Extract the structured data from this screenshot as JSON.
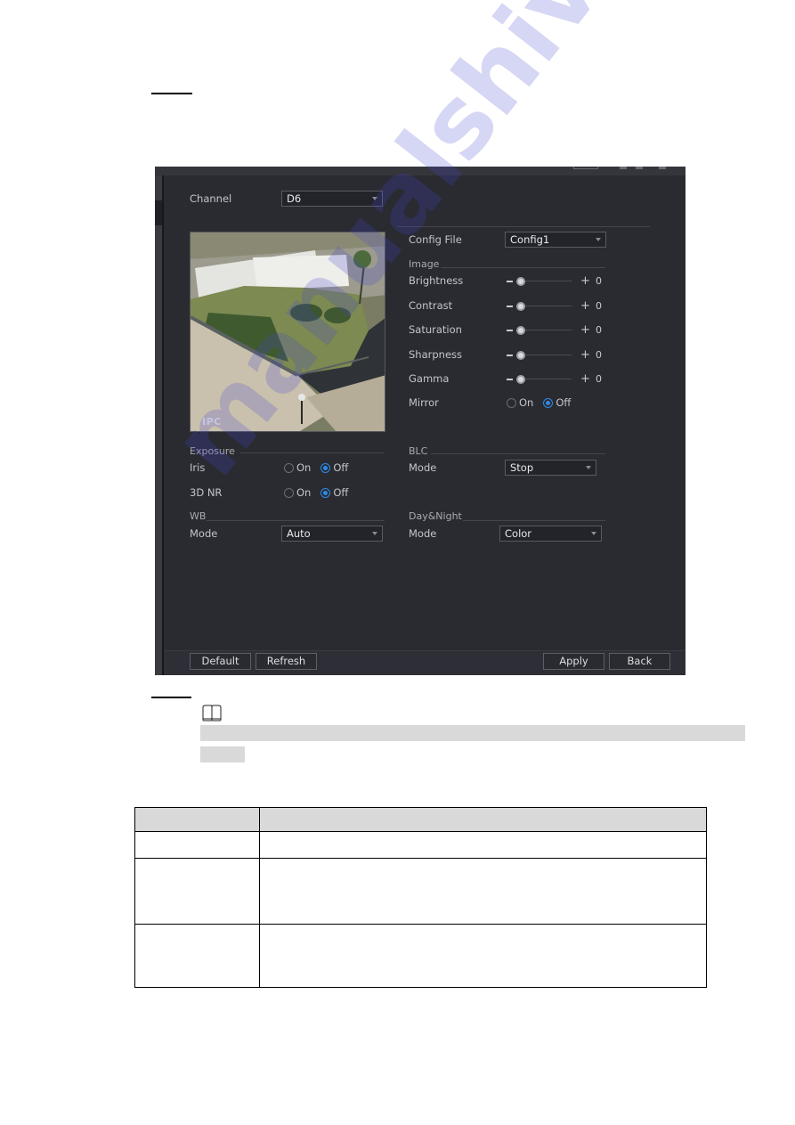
{
  "document": {
    "watermark": "manualshive.com",
    "note_icon": "book-icon",
    "table": {
      "header": [
        "",
        ""
      ],
      "rows": [
        [
          "",
          ""
        ],
        [
          "",
          ""
        ],
        [
          "",
          ""
        ]
      ]
    }
  },
  "ui": {
    "channel": {
      "label": "Channel",
      "value": "D6"
    },
    "preview": {
      "overlay_text": "IPC"
    },
    "config_file": {
      "label": "Config File",
      "value": "Config1"
    },
    "image_group": {
      "title": "Image",
      "sliders": [
        {
          "label": "Brightness",
          "value": "0",
          "position": 0.0
        },
        {
          "label": "Contrast",
          "value": "0",
          "position": 0.0
        },
        {
          "label": "Saturation",
          "value": "0",
          "position": 0.0
        },
        {
          "label": "Sharpness",
          "value": "0",
          "position": 0.0
        },
        {
          "label": "Gamma",
          "value": "0",
          "position": 0.0
        }
      ],
      "mirror": {
        "label": "Mirror",
        "options": [
          "On",
          "Off"
        ],
        "selected": "Off"
      }
    },
    "exposure": {
      "title": "Exposure",
      "iris": {
        "label": "Iris",
        "options": [
          "On",
          "Off"
        ],
        "selected": "Off"
      },
      "nr3d": {
        "label": "3D NR",
        "options": [
          "On",
          "Off"
        ],
        "selected": "Off"
      }
    },
    "blc": {
      "title": "BLC",
      "mode_label": "Mode",
      "mode_value": "Stop"
    },
    "wb": {
      "title": "WB",
      "mode_label": "Mode",
      "mode_value": "Auto"
    },
    "day_night": {
      "title": "Day&Night",
      "mode_label": "Mode",
      "mode_value": "Color"
    },
    "buttons": {
      "default": "Default",
      "refresh": "Refresh",
      "apply": "Apply",
      "back": "Back"
    },
    "colors": {
      "background": "#2a2b31",
      "accent": "#2e8be6"
    }
  }
}
